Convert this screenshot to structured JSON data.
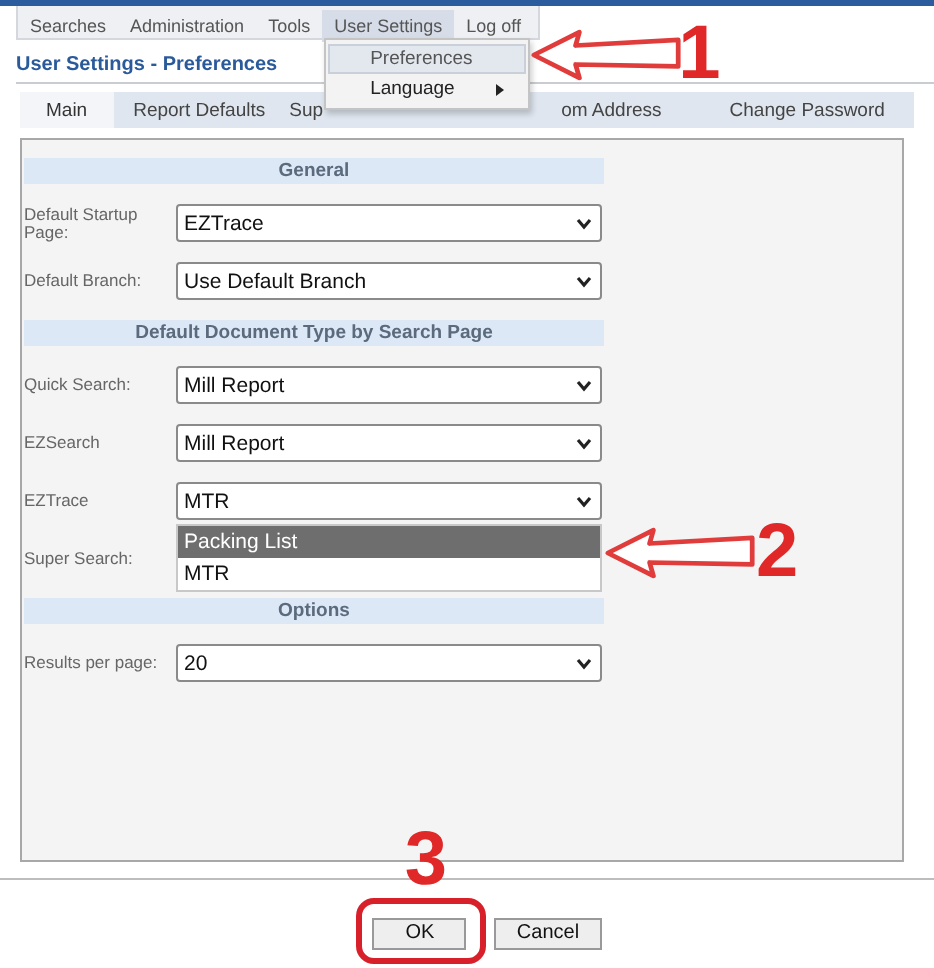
{
  "menu_bar": [
    {
      "label": "Searches",
      "selected": false
    },
    {
      "label": "Administration",
      "selected": false
    },
    {
      "label": "Tools",
      "selected": false
    },
    {
      "label": "User Settings",
      "selected": true
    },
    {
      "label": "Log off",
      "selected": false
    }
  ],
  "user_menu": [
    {
      "label": "Preferences",
      "selected": true,
      "submenu": false,
      "annotation": "1"
    },
    {
      "label": "Language",
      "selected": false,
      "submenu": true
    }
  ],
  "page_title": "User Settings - Preferences",
  "tabs": [
    {
      "label": "Main",
      "selected": true
    },
    {
      "label": "Report Defaults",
      "selected": false
    },
    {
      "label": "Sup",
      "selected": false
    },
    {
      "label": "om Address",
      "selected": false
    },
    {
      "label": "Change Password",
      "selected": false
    }
  ],
  "sections": [
    {
      "title": "General",
      "fields": [
        {
          "label": "Default Startup Page:",
          "value": "EZTrace"
        },
        {
          "label": "Default Branch:",
          "value": "Use Default Branch"
        }
      ]
    },
    {
      "title": "Default Document Type by Search Page",
      "fields": [
        {
          "label": "Quick Search:",
          "value": "Mill Report"
        },
        {
          "label": "EZSearch",
          "value": "Mill Report"
        },
        {
          "label": "EZTrace",
          "value": "MTR",
          "open": true,
          "annotation": "2",
          "options": [
            {
              "label": "Packing List",
              "highlighted": true
            },
            {
              "label": "MTR",
              "highlighted": false
            }
          ]
        },
        {
          "label": "Super Search:"
        }
      ]
    },
    {
      "title": "Options",
      "fields": [
        {
          "label": "Results per page:",
          "value": "20"
        }
      ]
    }
  ],
  "buttons": [
    {
      "label": "OK",
      "annotation": "3"
    },
    {
      "label": "Cancel"
    }
  ]
}
